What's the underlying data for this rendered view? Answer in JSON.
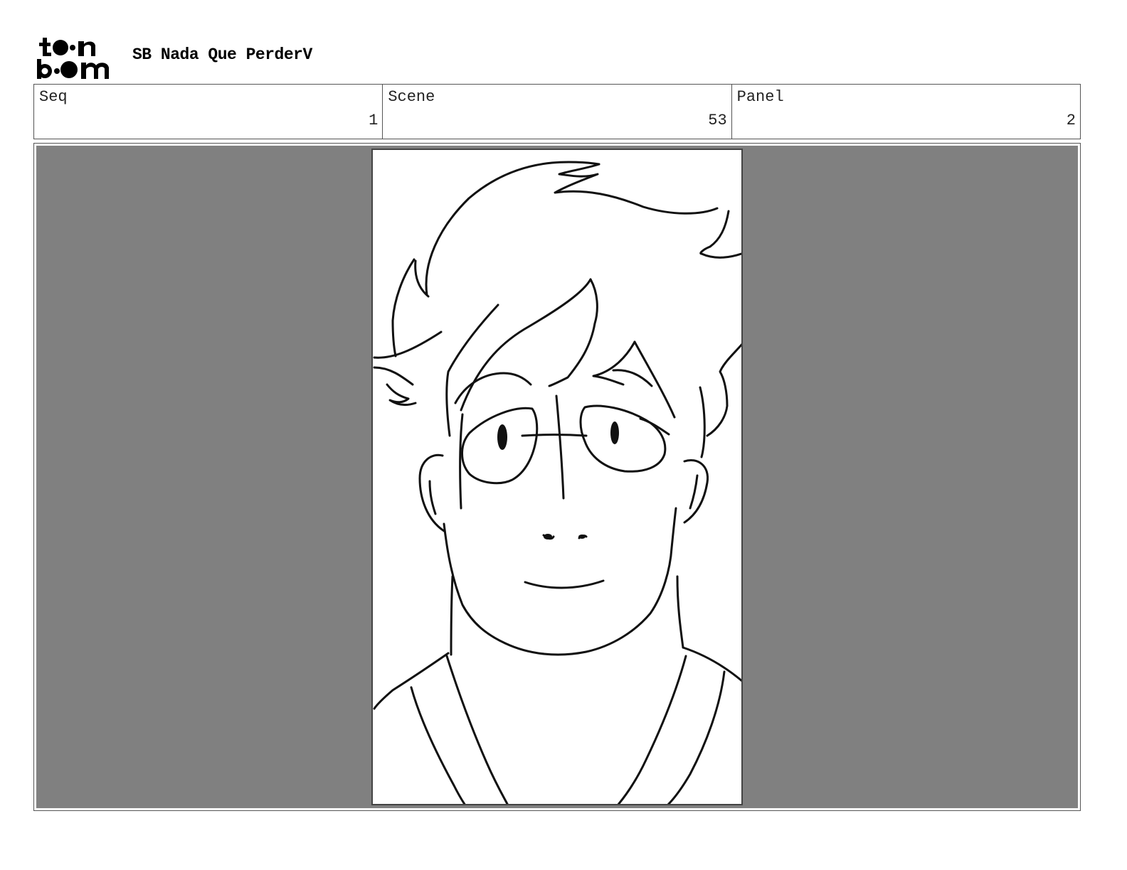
{
  "header": {
    "logo_icon": "toonboom-logo-icon",
    "project_title": "SB Nada Que PerderV"
  },
  "info": {
    "seq_label": "Seq",
    "seq_value": "1",
    "scene_label": "Scene",
    "scene_value": "53",
    "panel_label": "Panel",
    "panel_value": "2"
  },
  "colors": {
    "frame_background": "#808080",
    "drawing_background": "#ffffff",
    "line": "#111111"
  },
  "panel_image": {
    "icon": "sketch-character-portrait-icon"
  }
}
